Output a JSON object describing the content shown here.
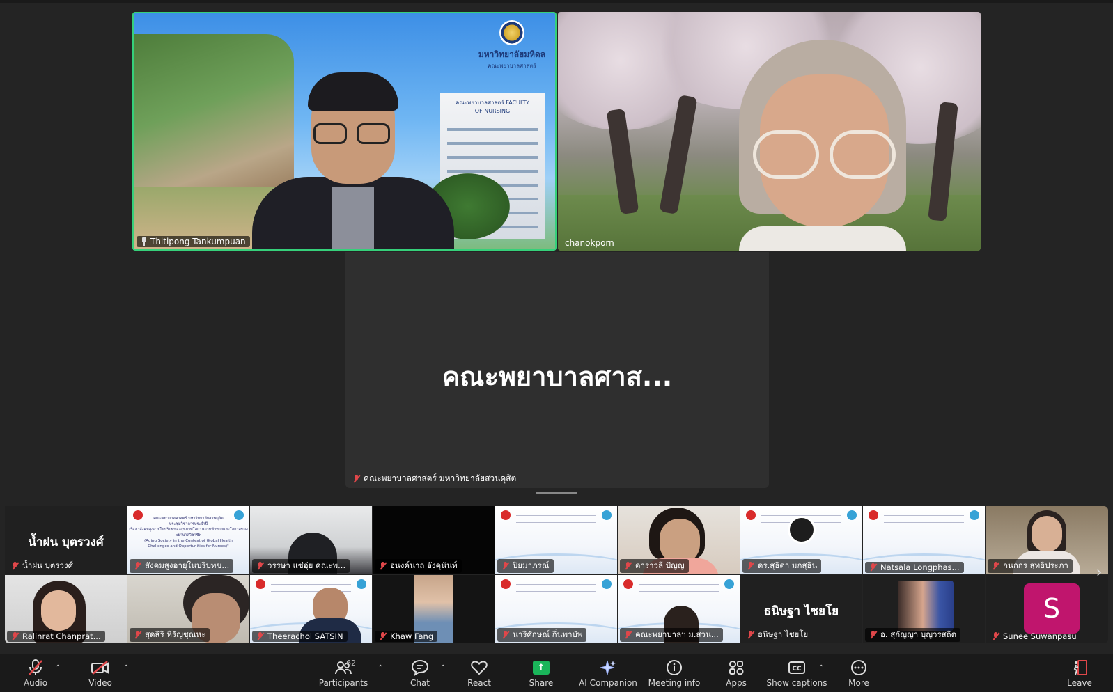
{
  "speakers": [
    {
      "name": "Thitipong Tankumpuan"
    },
    {
      "name": "chanokporn"
    }
  ],
  "logo": {
    "line1": "มหาวิทยาลัยมหิดล",
    "line2": "คณะพยาบาลศาสตร์",
    "building_sign": "คณะพยาบาลศาสตร์ FACULTY OF NURSING"
  },
  "center_tile": {
    "display_name": "คณะพยาบาลศาส...",
    "name": "คณะพยาบาลศาสตร์ มหาวิทยาลัยสวนดุสิต"
  },
  "gallery": [
    {
      "name": "น้ำฝน บุตรวงศ์",
      "type": "name",
      "display": "น้ำฝน บุตรวงศ์"
    },
    {
      "name": "สังคมสูงอายุในบริบทข...",
      "type": "slide-doc"
    },
    {
      "name": "วรรษา แซ่อุ่ย คณะพ...",
      "type": "video"
    },
    {
      "name": "อนงค์นาถ อังคุนันท์",
      "type": "dark"
    },
    {
      "name": "ปิยมาภรณ์",
      "type": "slide"
    },
    {
      "name": "ดาราวลี ปัญญ",
      "type": "video"
    },
    {
      "name": "ดร.สุธิดา มกสุธิน",
      "type": "slide"
    },
    {
      "name": "Natsala Longphas...",
      "type": "slide"
    },
    {
      "name": "กนกกร สุทธิประภา",
      "type": "video"
    },
    {
      "name": "Ralinrat Chanprat...",
      "type": "video"
    },
    {
      "name": "สุดสิริ หิรัญชุณหะ",
      "type": "video"
    },
    {
      "name": "Theerachol SATSIN",
      "type": "video"
    },
    {
      "name": "Khaw Fang",
      "type": "video"
    },
    {
      "name": "นาริศักษณ์ กิ่นพาบัพ",
      "type": "slide"
    },
    {
      "name": "คณะพยาบาลฯ ม.สวน...",
      "type": "slide"
    },
    {
      "name": "ธนิษฐา ไชยโย",
      "type": "name",
      "display": "ธนิษฐา ไชยโย"
    },
    {
      "name": "อ. สุกัญญา บุญวรสถิต",
      "type": "video"
    },
    {
      "name": "Sunee Suwanpasu",
      "type": "avatar",
      "initial": "S"
    }
  ],
  "slide_doc": {
    "line1": "คณะพยาบาลศาสตร์ มหาวิทยาลัยสวนดุสิต",
    "line2": "ประชุมวิชาการประจำปี",
    "line3": "เรื่อง \"สังคมสูงอายุในบริบทของสุขภาพโลก: ความท้าทายและโอกาสของพยาบาลวิชาชีพ",
    "line4": "(Aging Society in the Context of Global Health",
    "line5": "Challenges and Opportunities for Nurses)\""
  },
  "toolbar": {
    "audio": "Audio",
    "video": "Video",
    "participants": "Participants",
    "participants_count": "62",
    "chat": "Chat",
    "react": "React",
    "share": "Share",
    "ai_companion": "AI Companion",
    "meeting_info": "Meeting info",
    "apps": "Apps",
    "show_captions": "Show captions",
    "more": "More",
    "leave": "Leave"
  },
  "colors": {
    "active_speaker_border": "#36d07a",
    "share_green": "#1ab55a",
    "mute_red": "#e0474a",
    "avatar_magenta": "#c0156d"
  }
}
